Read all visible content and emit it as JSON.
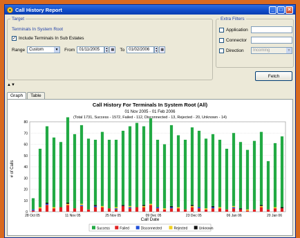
{
  "window": {
    "title": "Call History Report"
  },
  "target": {
    "legend": "Target",
    "location": "Terminals In System Root",
    "include_sub_label": "Include Terminals In Sub Estates",
    "include_sub_checked": true,
    "range_label": "Range",
    "range_value": "Custom",
    "from_label": "From",
    "from_value": "01/11/2005",
    "to_label": "To",
    "to_value": "01/02/2006"
  },
  "filters": {
    "legend": "Extra Filters",
    "application_label": "Application",
    "application_value": "",
    "connector_label": "Connector",
    "connector_value": "",
    "direction_label": "Direction",
    "direction_value": "Incoming"
  },
  "fetch_label": "Fetch",
  "tabs": [
    {
      "label": "Graph"
    },
    {
      "label": "Table"
    }
  ],
  "chart_data": {
    "type": "bar",
    "title": "Call History For Terminals In System Root (All)",
    "subtitle": "01 Nov 2005 - 01 Feb 2006",
    "summary": "(Total 1731, Success - 1572, Failed - 112, Disconnected - 13, Rejected - 20, Unknown - 14)",
    "xlabel": "Call Date",
    "ylabel": "# of Calls",
    "ylim": [
      0,
      80
    ],
    "yticks": [
      0,
      10,
      20,
      30,
      40,
      50,
      60,
      70,
      80
    ],
    "xtick_labels": [
      "28 Oct 05",
      "11 Nov 05",
      "25 Nov 05",
      "09 Dec 05",
      "23 Dec 05",
      "06 Jan 06",
      "20 Jan 06"
    ],
    "legend": [
      {
        "name": "Success",
        "color": "#22aa44"
      },
      {
        "name": "Failed",
        "color": "#e02020"
      },
      {
        "name": "Disconnected",
        "color": "#2050d8"
      },
      {
        "name": "Rejected",
        "color": "#f0d020"
      },
      {
        "name": "Unknown",
        "color": "#111111"
      }
    ],
    "series": [
      {
        "name": "Success",
        "values": [
          10,
          52,
          68,
          62,
          58,
          76,
          66,
          70,
          63,
          58,
          66,
          61,
          60,
          66,
          71,
          75,
          70,
          76,
          60,
          57,
          72,
          64,
          62,
          69,
          68,
          62,
          64,
          60,
          54,
          65,
          59,
          53,
          61,
          65,
          43,
          57,
          63
        ]
      },
      {
        "name": "Failed",
        "values": [
          1,
          3,
          6,
          3,
          4,
          6,
          3,
          5,
          2,
          4,
          4,
          3,
          2,
          5,
          3,
          4,
          4,
          6,
          3,
          2,
          3,
          3,
          2,
          4,
          3,
          2,
          3,
          3,
          2,
          3,
          2,
          1,
          2,
          4,
          2,
          3,
          3
        ]
      },
      {
        "name": "Disconnected",
        "values": [
          1,
          0,
          1,
          0,
          0,
          0,
          0,
          1,
          0,
          1,
          0,
          0,
          1,
          0,
          1,
          0,
          0,
          0,
          1,
          0,
          1,
          0,
          0,
          0,
          1,
          0,
          1,
          0,
          0,
          1,
          0,
          0,
          0,
          0,
          0,
          0,
          0
        ]
      },
      {
        "name": "Rejected",
        "values": [
          0,
          1,
          0,
          1,
          0,
          1,
          0,
          1,
          0,
          0,
          1,
          0,
          1,
          0,
          1,
          0,
          1,
          1,
          0,
          1,
          0,
          1,
          0,
          1,
          0,
          1,
          0,
          1,
          0,
          1,
          0,
          1,
          0,
          1,
          0,
          1,
          0
        ]
      },
      {
        "name": "Unknown",
        "values": [
          0,
          0,
          1,
          0,
          0,
          1,
          0,
          0,
          0,
          1,
          0,
          0,
          0,
          1,
          0,
          0,
          1,
          0,
          0,
          0,
          1,
          0,
          0,
          1,
          0,
          0,
          1,
          0,
          0,
          0,
          1,
          0,
          0,
          1,
          0,
          0,
          1
        ]
      }
    ]
  }
}
